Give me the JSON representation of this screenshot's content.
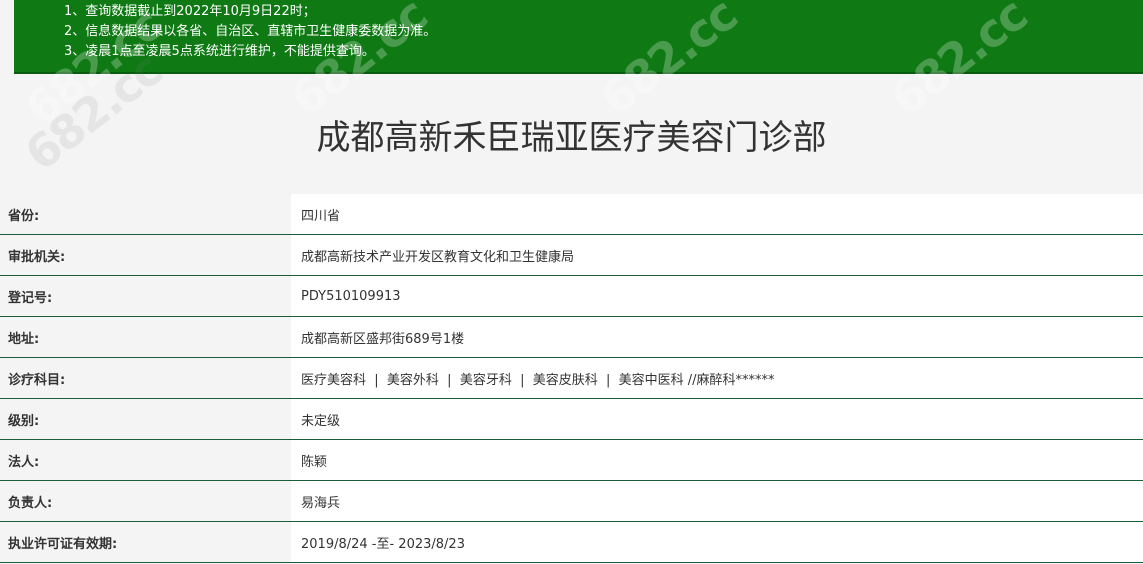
{
  "notice": {
    "lines": [
      "1、查询数据截止到2022年10月9日22时；",
      "2、信息数据结果以各省、自治区、直辖市卫生健康委数据为准。",
      "3、凌晨1点至凌晨5点系统进行维护，不能提供查询。"
    ],
    "background_color": "#0f7a14"
  },
  "watermark": {
    "text": "682.cc"
  },
  "title": "成都高新禾臣瑞亚医疗美容门诊部",
  "rows": [
    {
      "label": "省份:",
      "value": "四川省"
    },
    {
      "label": "审批机关:",
      "value": "成都高新技术产业开发区教育文化和卫生健康局"
    },
    {
      "label": "登记号:",
      "value": "PDY510109913"
    },
    {
      "label": "地址:",
      "value": "成都高新区盛邦街689号1楼"
    },
    {
      "label": "诊疗科目:",
      "value": "医疗美容科  |  美容外科  |  美容牙科  |  美容皮肤科  |  美容中医科 //麻醉科******"
    },
    {
      "label": "级别:",
      "value": "未定级"
    },
    {
      "label": "法人:",
      "value": "陈颖"
    },
    {
      "label": "负责人:",
      "value": "易海兵"
    },
    {
      "label": "执业许可证有效期:",
      "value": "2019/8/24 -至- 2023/8/23"
    }
  ]
}
